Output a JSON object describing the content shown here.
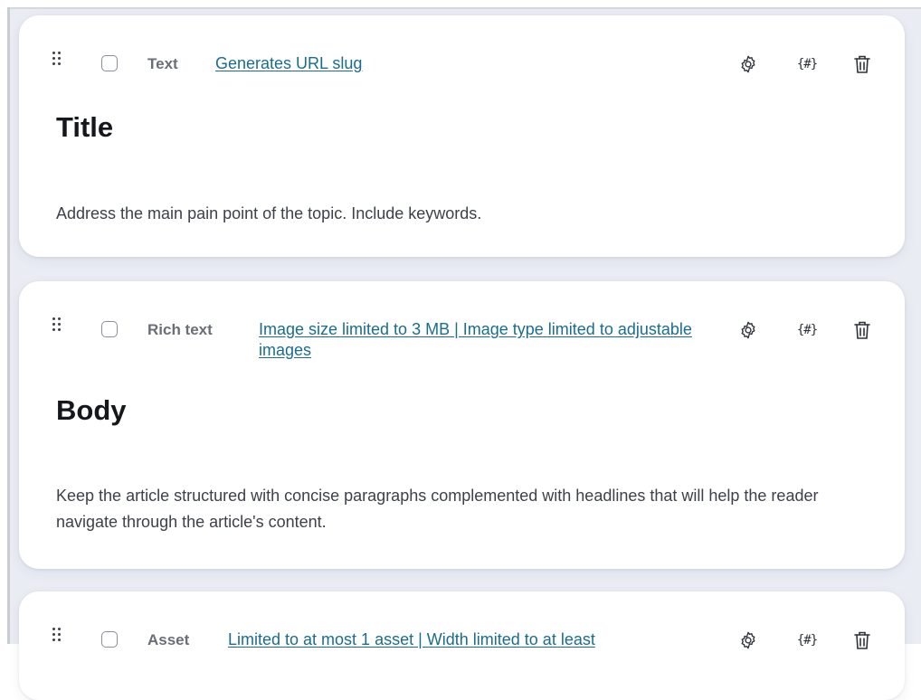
{
  "fields": [
    {
      "type": "Text",
      "constraint": "Generates URL slug",
      "title": "Title",
      "description": "Address the main pain point of the topic. Include keywords."
    },
    {
      "type": "Rich text",
      "constraint": "Image size limited to 3 MB | Image type limited to adjustable images",
      "title": "Body",
      "description": "Keep the article structured with concise paragraphs complemented with headlines that will help the reader navigate through the article's content."
    },
    {
      "type": "Asset",
      "constraint": "Limited to at most 1 asset | Width limited to at least"
    }
  ],
  "icons": {
    "drag": "drag-handle-icon",
    "settings": "gear-icon",
    "snippet": "hash-braces-icon",
    "delete": "trash-icon"
  },
  "colors": {
    "link": "#1a6d8d",
    "background": "#e9ecf3",
    "card": "#ffffff"
  }
}
